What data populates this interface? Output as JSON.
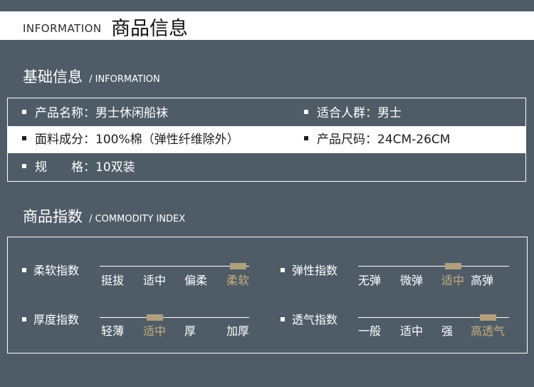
{
  "header": {
    "en": "INFORMATION",
    "zh": "商品信息"
  },
  "basic": {
    "title": "基础信息",
    "subtitle": "/ INFORMATION",
    "rows": [
      [
        "产品名称：男士休闲船袜",
        "适合人群：男士"
      ],
      [
        "面料成分：100%棉（弹性纤维除外）",
        "产品尺码：24CM-26CM"
      ],
      [
        "规　　格：10双装"
      ]
    ]
  },
  "index": {
    "title": "商品指数",
    "subtitle": "/ COMMODITY INDEX",
    "items": [
      {
        "label": "柔软指数",
        "options": [
          "挺拔",
          "适中",
          "偏柔",
          "柔软"
        ],
        "selected": 3
      },
      {
        "label": "弹性指数",
        "options": [
          "无弹",
          "微弹",
          "适中",
          "高弹"
        ],
        "selected": 2
      },
      {
        "label": "厚度指数",
        "options": [
          "轻薄",
          "适中",
          "厚",
          "加厚"
        ],
        "selected": 1
      },
      {
        "label": "透气指数",
        "options": [
          "一般",
          "适中",
          "强",
          "高透气"
        ],
        "selected": 3
      }
    ]
  },
  "colors": {
    "background": "#4f5c67",
    "accent": "#b29f7d",
    "selected_text": "#c7ad7f"
  }
}
